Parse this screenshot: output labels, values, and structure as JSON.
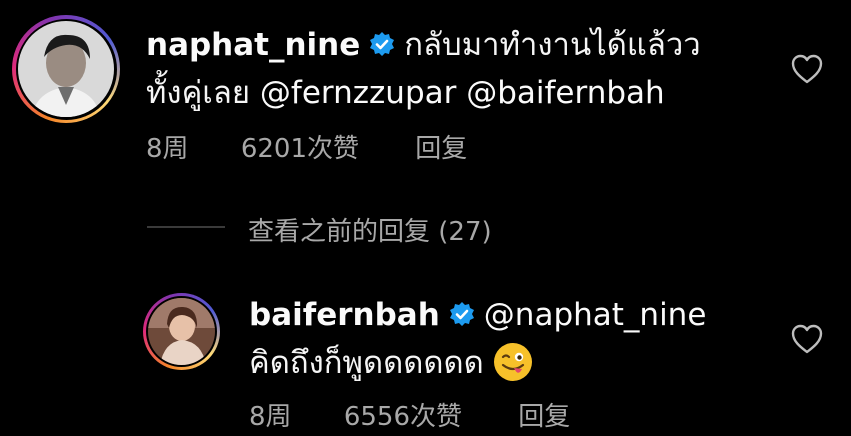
{
  "comments": [
    {
      "username": "naphat_nine",
      "line1": "กลับมาทำงานได้แล้วว",
      "line2_prefix": "ทั้งคู่เลย ",
      "mentions": [
        "@fernzzupar",
        "@baifernbah"
      ],
      "time": "8周",
      "likes": "6201次赞",
      "reply": "回复"
    },
    {
      "username": "baifernbah",
      "mention": "@naphat_nine",
      "line2": "คิดถึงก็พูดดดดดด",
      "emoji": "winking-tongue-face",
      "time": "8周",
      "likes": "6556次赞",
      "reply": "回复"
    }
  ],
  "view_previous": "查看之前的回复 (27)",
  "colors": {
    "background": "#000000",
    "text": "#f5f5f5",
    "muted": "#a8a8a8",
    "verified": "#1d9bf0"
  }
}
